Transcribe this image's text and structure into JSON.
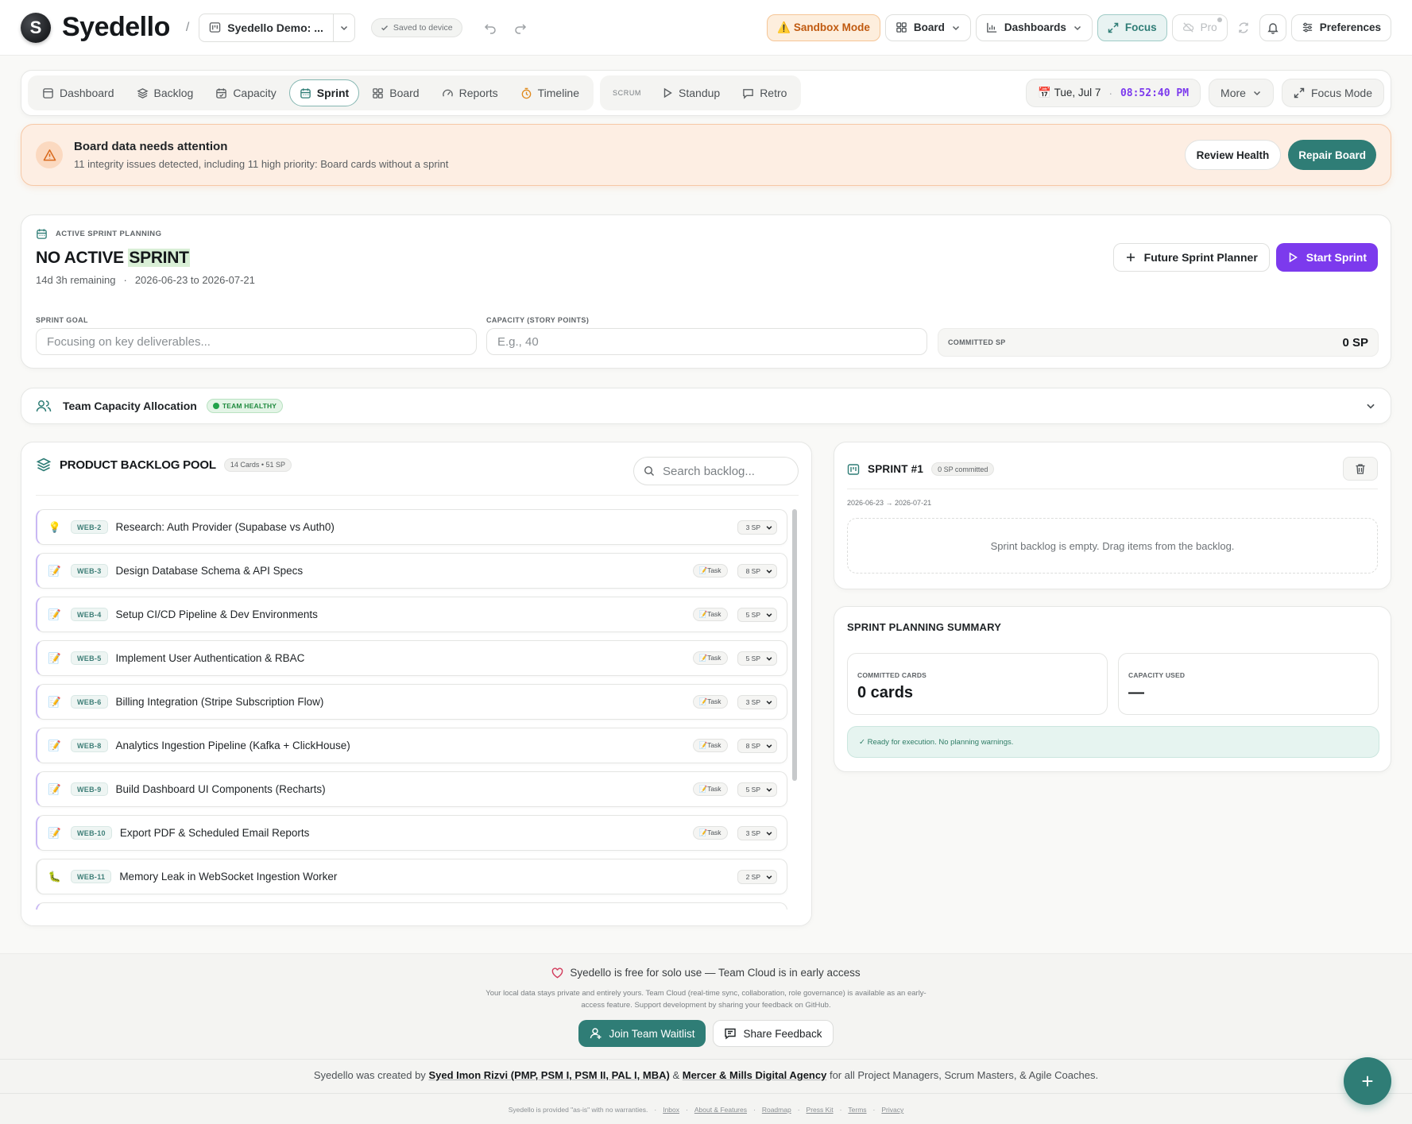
{
  "header": {
    "brand": "Syedello",
    "breadcrumb_sep": "/",
    "project_name": "Syedello Demo: ...",
    "saved_label": "Saved to device",
    "sandbox_label": "⚠️ Sandbox Mode",
    "board_label": "Board",
    "dashboards_label": "Dashboards",
    "focus_label": "Focus",
    "pro_label": "Pro",
    "preferences_label": "Preferences"
  },
  "nav": {
    "items": [
      {
        "label": "Dashboard",
        "icon": "dashboard-icon"
      },
      {
        "label": "Backlog",
        "icon": "layers-icon"
      },
      {
        "label": "Capacity",
        "icon": "calendar-check-icon"
      },
      {
        "label": "Sprint",
        "icon": "calendar-icon",
        "active": true
      },
      {
        "label": "Board",
        "icon": "grid-icon"
      },
      {
        "label": "Reports",
        "icon": "gauge-icon"
      },
      {
        "label": "Timeline",
        "icon": "timer-icon"
      }
    ],
    "scrum_tag": "SCRUM",
    "scrum_items": [
      {
        "label": "Standup",
        "icon": "play-icon"
      },
      {
        "label": "Retro",
        "icon": "message-icon"
      }
    ],
    "date": "📅 Tue, Jul 7",
    "date_sep": "·",
    "time": "08:52:40 PM",
    "more_label": "More",
    "focus_mode_label": "Focus Mode"
  },
  "alert": {
    "title": "Board data needs attention",
    "message": "11 integrity issues detected, including 11 high priority: Board cards without a sprint",
    "review_label": "Review Health",
    "repair_label": "Repair Board"
  },
  "sprint": {
    "eyebrow": "ACTIVE SPRINT PLANNING",
    "title_prefix": "NO ACTIVE ",
    "title_highlight": "SPRINT",
    "remaining": "14d 3h remaining",
    "meta_sep": "·",
    "range": "2026-06-23 to 2026-07-21",
    "future_label": "Future Sprint Planner",
    "start_label": "Start Sprint",
    "goal_label": "SPRINT GOAL",
    "goal_placeholder": "Focusing on key deliverables...",
    "capacity_label": "CAPACITY (STORY POINTS)",
    "capacity_placeholder": "E.g., 40",
    "committed_label": "COMMITTED SP",
    "committed_value": "0 SP"
  },
  "team": {
    "title": "Team Capacity Allocation",
    "badge": "TEAM HEALTHY"
  },
  "backlog": {
    "title": "PRODUCT BACKLOG POOL",
    "count": "14 Cards • 51 SP",
    "search_placeholder": "Search backlog...",
    "items": [
      {
        "emoji": "💡",
        "id": "WEB-2",
        "title": "Research: Auth Provider (Supabase vs Auth0)",
        "type": "",
        "sp": "3 SP"
      },
      {
        "emoji": "📝",
        "id": "WEB-3",
        "title": "Design Database Schema & API Specs",
        "type": "📝Task",
        "sp": "8 SP"
      },
      {
        "emoji": "📝",
        "id": "WEB-4",
        "title": "Setup CI/CD Pipeline & Dev Environments",
        "type": "📝Task",
        "sp": "5 SP"
      },
      {
        "emoji": "📝",
        "id": "WEB-5",
        "title": "Implement User Authentication & RBAC",
        "type": "📝Task",
        "sp": "5 SP"
      },
      {
        "emoji": "📝",
        "id": "WEB-6",
        "title": "Billing Integration (Stripe Subscription Flow)",
        "type": "📝Task",
        "sp": "3 SP"
      },
      {
        "emoji": "📝",
        "id": "WEB-8",
        "title": "Analytics Ingestion Pipeline (Kafka + ClickHouse)",
        "type": "📝Task",
        "sp": "8 SP"
      },
      {
        "emoji": "📝",
        "id": "WEB-9",
        "title": "Build Dashboard UI Components (Recharts)",
        "type": "📝Task",
        "sp": "5 SP"
      },
      {
        "emoji": "📝",
        "id": "WEB-10",
        "title": "Export PDF & Scheduled Email Reports",
        "type": "📝Task",
        "sp": "3 SP"
      },
      {
        "emoji": "🐛",
        "id": "WEB-11",
        "title": "Memory Leak in WebSocket Ingestion Worker",
        "type": "",
        "sp": "2 SP"
      }
    ]
  },
  "sprint1": {
    "title": "SPRINT #1",
    "committed": "0 SP committed",
    "dates": "2026-06-23 → 2026-07-21",
    "empty": "Sprint backlog is empty. Drag items from the backlog."
  },
  "summary": {
    "title": "SPRINT PLANNING SUMMARY",
    "cards_label": "COMMITTED CARDS",
    "cards_value": "0 cards",
    "capacity_label": "CAPACITY USED",
    "capacity_value": "—",
    "ready": "✓ Ready for execution. No planning warnings."
  },
  "footer": {
    "headline": "Syedello is free for solo use — Team Cloud is in early access",
    "body": "Your local data stays private and entirely yours. Team Cloud (real-time sync, collaboration, role governance) is available as an early-access feature. Support development by sharing your feedback on GitHub.",
    "join_label": "Join Team Waitlist",
    "feedback_label": "Share Feedback",
    "credit_pre": "Syedello was created by",
    "credit_author": "Syed Imon Rizvi (PMP, PSM I, PSM II, PAL I, MBA)",
    "credit_amp": "&",
    "credit_agency": "Mercer & Mills Digital Agency",
    "credit_post": "for all Project Managers, Scrum Masters, & Agile Coaches.",
    "legal_note": "Syedello is provided \"as-is\" with no warranties.",
    "legal_links": [
      "Inbox",
      "About & Features",
      "Roadmap",
      "Press Kit",
      "Terms",
      "Privacy"
    ],
    "legal_sep": "·"
  },
  "fab_label": "+",
  "colors": {
    "accent_teal": "#2f7d76",
    "accent_purple": "#7c3aed",
    "alert_bg": "#fdeee3",
    "sandbox_text": "#c05a10"
  }
}
